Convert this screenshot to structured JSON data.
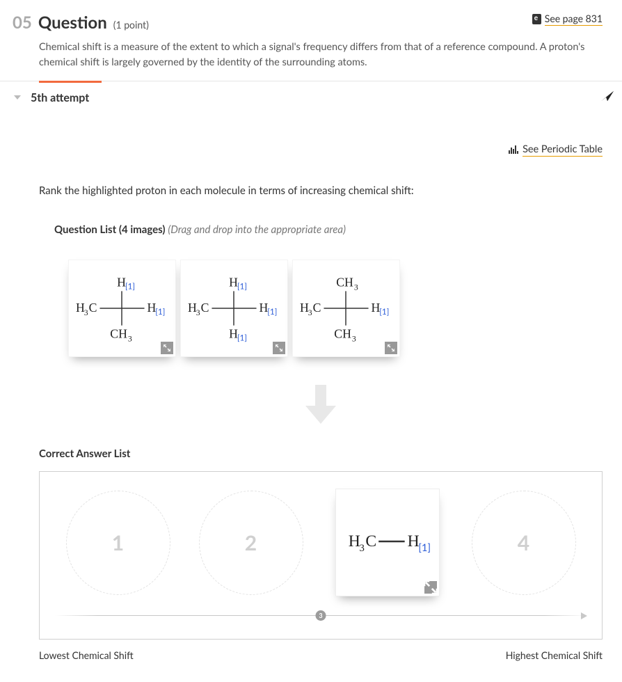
{
  "header": {
    "number": "05",
    "word": "Question",
    "points": "(1 point)",
    "see_page": "See page 831",
    "description": "Chemical shift is a measure of the extent to which a signal's frequency differs from that of a reference compound.  A proton's chemical shift is largely governed by the identity of the surrounding atoms."
  },
  "attempt": {
    "label": "5th attempt"
  },
  "links": {
    "periodic": "See Periodic Table"
  },
  "instruction": "Rank the highlighted proton in each molecule in terms of increasing chemical shift:",
  "question_list": {
    "title": "Question List (4 images)",
    "hint": "(Drag and drop into the appropriate area)"
  },
  "molecules": {
    "items": [
      {
        "id": "mol-a",
        "top": "H[1]",
        "left": "H3C",
        "right": "H[1]",
        "bottom": "CH3"
      },
      {
        "id": "mol-b",
        "top": "H[1]",
        "left": "H3C",
        "right": "H[1]",
        "bottom": "H[1]"
      },
      {
        "id": "mol-c",
        "top": "CH3",
        "left": "H3C",
        "right": "H[1]",
        "bottom": "CH3"
      }
    ]
  },
  "answer": {
    "title": "Correct Answer List",
    "slots": [
      "1",
      "2",
      "3",
      "4"
    ],
    "filled_index": 2,
    "filled_molecule": "H3C—H[1]",
    "badge": "3",
    "low_label": "Lowest Chemical Shift",
    "high_label": "Highest Chemical Shift"
  }
}
